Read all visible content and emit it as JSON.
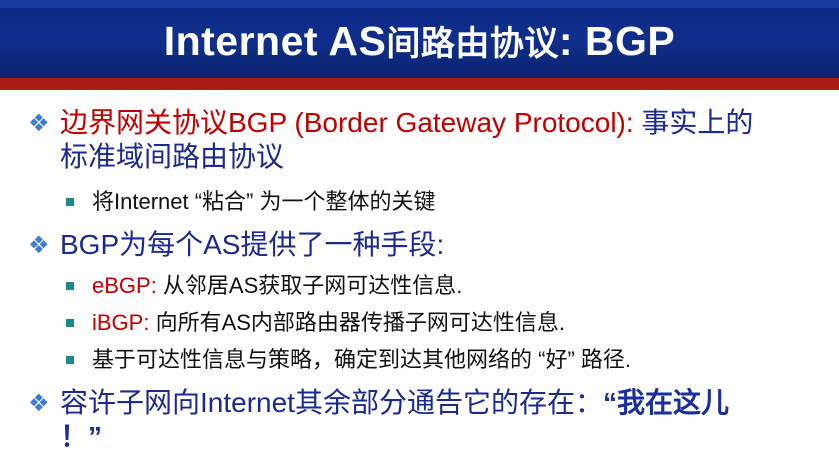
{
  "title": {
    "part1": "Internet AS",
    "part2": "间路由协议",
    "part3": ": BGP"
  },
  "bullets": [
    {
      "red": "边界网关协议BGP (Border Gateway Protocol):",
      "rest_line1": " 事实上的",
      "rest_line2": "标准域间路由协议"
    },
    {
      "sub": "将Internet “粘合” 为一个整体的关键"
    },
    {
      "text": "BGP为每个AS提供了一种手段:"
    },
    {
      "red": "eBGP:",
      "rest": " 从邻居AS获取子网可达性信息."
    },
    {
      "red": "iBGP:",
      "rest": " 向所有AS内部路由器传播子网可达性信息."
    },
    {
      "text": "基于可达性信息与策略，确定到达其他网络的 “好” 路径."
    },
    {
      "text": "容许子网向Internet其余部分通告它的存在：",
      "emph_line1": "“我在这儿",
      "emph_line2": "！”"
    }
  ],
  "colors": {
    "title_bg": "#0a2a86",
    "stripe": "#a81a1a",
    "level1_text": "#1b2a8f",
    "highlight": "#c00000",
    "diamond": "#3d7bd9",
    "square": "#1a8a8a"
  },
  "icons": {
    "level1_bullet": "diamond-bullet-icon",
    "level2_bullet": "square-bullet-icon"
  }
}
